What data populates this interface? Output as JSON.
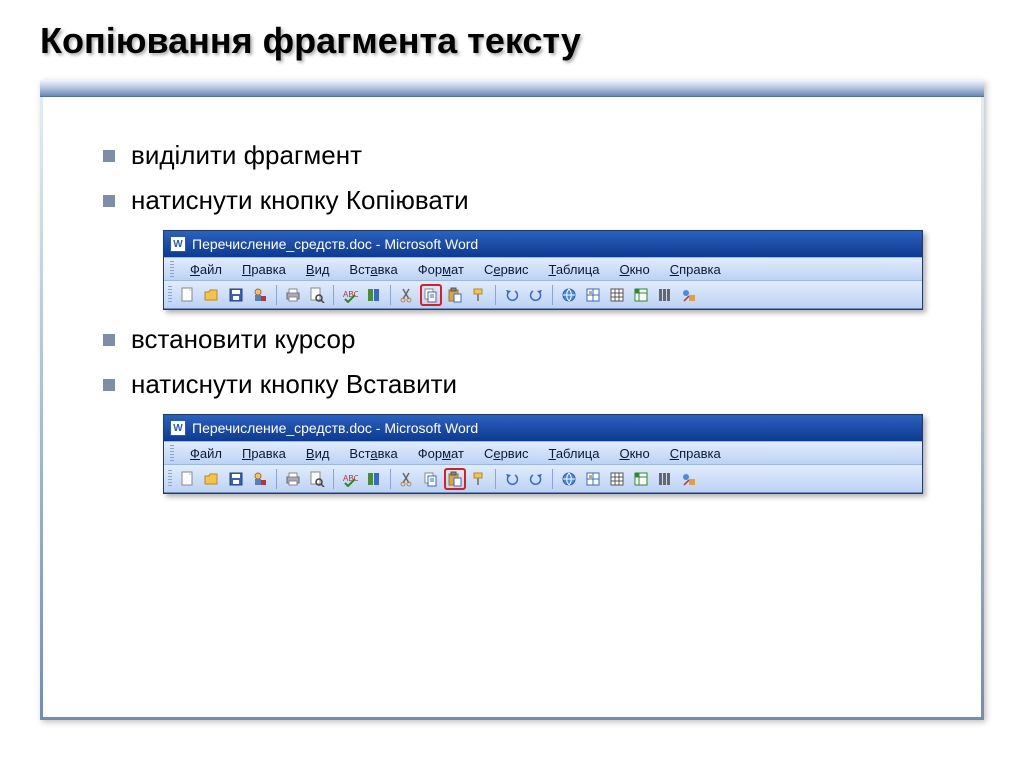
{
  "title": "Копіювання фрагмента тексту",
  "bullets": {
    "b1": "виділити фрагмент",
    "b2": "натиснути кнопку Копіювати",
    "b3": "встановити курсор",
    "b4": "натиснути кнопку Вставити"
  },
  "word": {
    "title": "Перечисление_средств.doc - Microsoft Word",
    "menu": {
      "file": "Файл",
      "edit": "Правка",
      "view": "Вид",
      "insert": "Вставка",
      "format": "Формат",
      "tools": "Сервис",
      "table": "Таблица",
      "window": "Окно",
      "help": "Справка"
    }
  }
}
